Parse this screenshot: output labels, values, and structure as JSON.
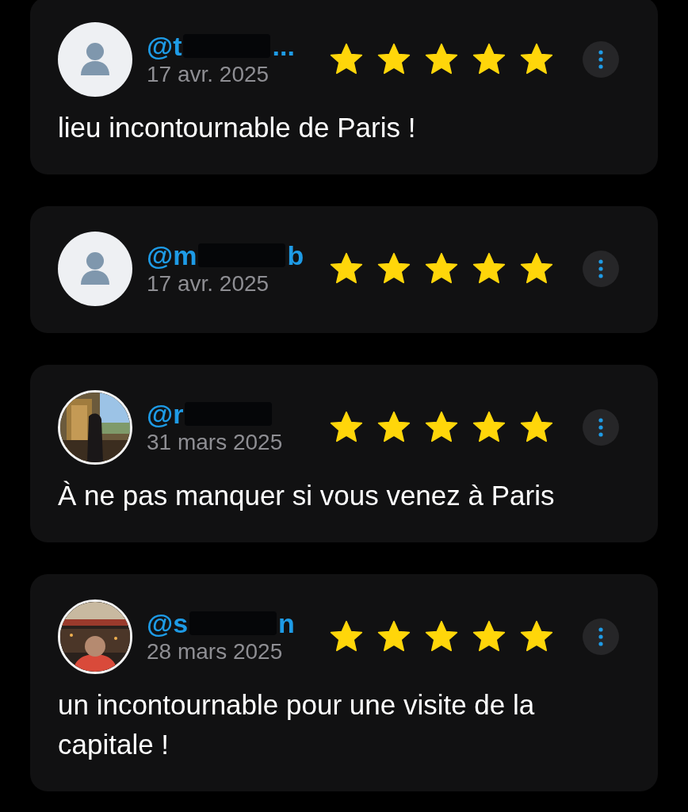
{
  "reviews": [
    {
      "avatar": {
        "kind": "default"
      },
      "handle": "@t",
      "handle_tail": "...",
      "date": "17 avr. 2025",
      "stars": 5,
      "text": "lieu incontournable de Paris !"
    },
    {
      "avatar": {
        "kind": "default"
      },
      "handle": "@m",
      "handle_tail": "b",
      "date": "17 avr. 2025",
      "stars": 5
    },
    {
      "handle": "@r",
      "date": "31 mars 2025",
      "stars": 5,
      "text": "À ne pas manquer si vous venez à Paris"
    },
    {
      "handle": "@s",
      "handle_tail": "n",
      "date": "28 mars 2025",
      "stars": 5,
      "text": "un incontournable pour une visite de la capitale !"
    }
  ]
}
